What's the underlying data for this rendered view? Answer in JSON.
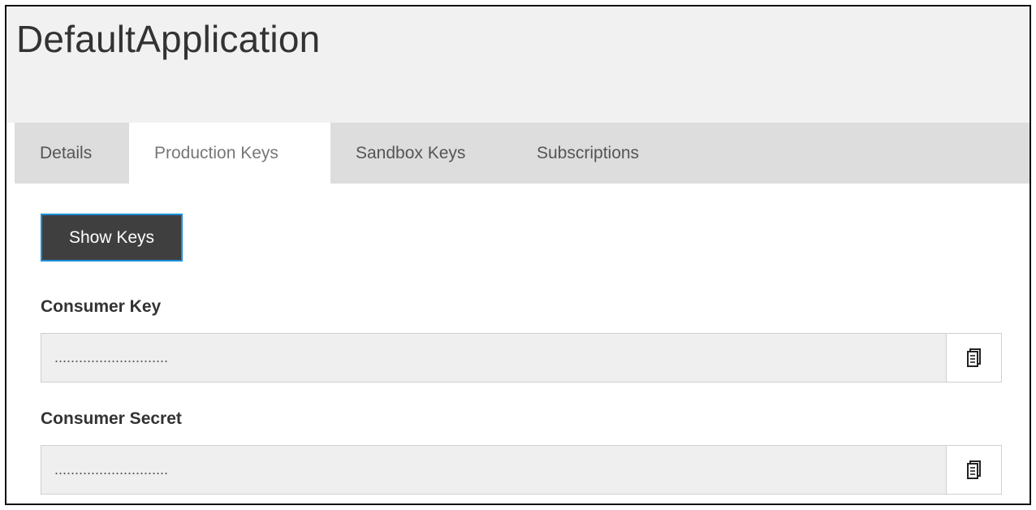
{
  "app": {
    "title": "DefaultApplication"
  },
  "tabs": [
    {
      "label": "Details",
      "active": false
    },
    {
      "label": "Production Keys",
      "active": true
    },
    {
      "label": "Sandbox Keys",
      "active": false
    },
    {
      "label": "Subscriptions",
      "active": false
    }
  ],
  "actions": {
    "show_keys_label": "Show Keys"
  },
  "consumer_key": {
    "label": "Consumer Key",
    "value": "............................",
    "copy_icon": "clipboard-icon"
  },
  "consumer_secret": {
    "label": "Consumer Secret",
    "value": "............................",
    "copy_icon": "clipboard-icon"
  },
  "colors": {
    "button_background": "#3f3f3f",
    "button_focus_border": "#1d8fd8",
    "tabbar_background": "#dddddd",
    "header_background": "#f1f1f1"
  }
}
